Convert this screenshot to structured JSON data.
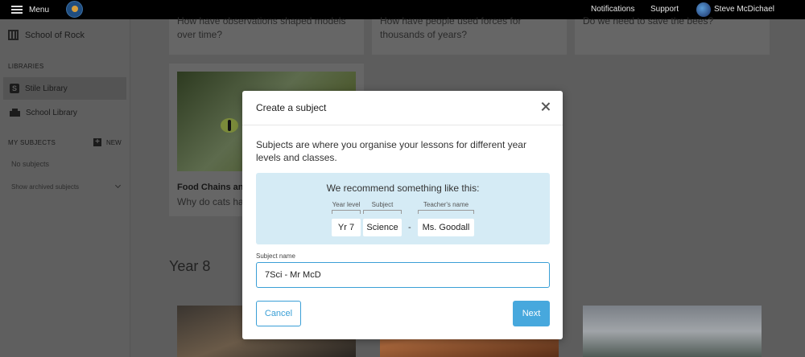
{
  "topbar": {
    "menu_label": "Menu",
    "notifications": "Notifications",
    "support": "Support",
    "user_name": "Steve McDichael"
  },
  "sidebar": {
    "school_name": "School of Rock",
    "libraries_heading": "LIBRARIES",
    "libraries": [
      {
        "label": "Stile Library",
        "icon": "stile-icon",
        "active": true
      },
      {
        "label": "School Library",
        "icon": "school-library-icon",
        "active": false
      }
    ],
    "my_subjects_heading": "MY SUBJECTS",
    "new_label": "NEW",
    "no_subjects": "No subjects",
    "show_archived": "Show archived subjects"
  },
  "main": {
    "card_top_1": "How have observations shaped models over time?",
    "card_top_2": "How have people used forces for thousands of years?",
    "card_top_3": "Do we need to save the bees?",
    "food_chains_title": "Food Chains and",
    "food_chains_subtitle": "Why do cats hav",
    "year8_heading": "Year 8"
  },
  "modal": {
    "title": "Create a subject",
    "description": "Subjects are where you organise your lessons for different year levels and classes.",
    "recommend_title": "We recommend something like this:",
    "labels": {
      "year_level": "Year level",
      "subject": "Subject",
      "teacher": "Teacher's name"
    },
    "chips": {
      "year": "Yr 7",
      "subject": "Science",
      "separator": "-",
      "teacher": "Ms. Goodall"
    },
    "field_label": "Subject name",
    "field_value": "7Sci - Mr McD",
    "cancel_label": "Cancel",
    "next_label": "Next"
  },
  "colors": {
    "accent": "#47a8dd",
    "recommend_bg": "#d5ebf5",
    "overlay": "#5d5d5d"
  }
}
